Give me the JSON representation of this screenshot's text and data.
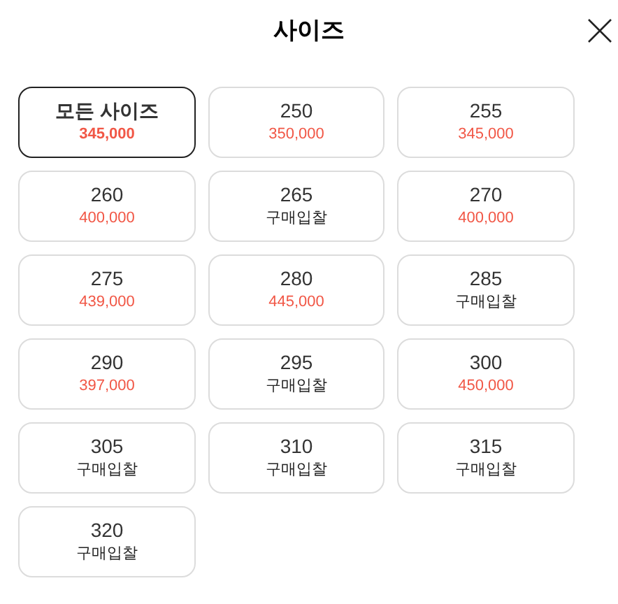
{
  "title": "사이즈",
  "sizes": [
    {
      "label": "모든 사이즈",
      "sub": "345,000",
      "kind": "price",
      "selected": true
    },
    {
      "label": "250",
      "sub": "350,000",
      "kind": "price",
      "selected": false
    },
    {
      "label": "255",
      "sub": "345,000",
      "kind": "price",
      "selected": false
    },
    {
      "label": "260",
      "sub": "400,000",
      "kind": "price",
      "selected": false
    },
    {
      "label": "265",
      "sub": "구매입찰",
      "kind": "bid",
      "selected": false
    },
    {
      "label": "270",
      "sub": "400,000",
      "kind": "price",
      "selected": false
    },
    {
      "label": "275",
      "sub": "439,000",
      "kind": "price",
      "selected": false
    },
    {
      "label": "280",
      "sub": "445,000",
      "kind": "price",
      "selected": false
    },
    {
      "label": "285",
      "sub": "구매입찰",
      "kind": "bid",
      "selected": false
    },
    {
      "label": "290",
      "sub": "397,000",
      "kind": "price",
      "selected": false
    },
    {
      "label": "295",
      "sub": "구매입찰",
      "kind": "bid",
      "selected": false
    },
    {
      "label": "300",
      "sub": "450,000",
      "kind": "price",
      "selected": false
    },
    {
      "label": "305",
      "sub": "구매입찰",
      "kind": "bid",
      "selected": false
    },
    {
      "label": "310",
      "sub": "구매입찰",
      "kind": "bid",
      "selected": false
    },
    {
      "label": "315",
      "sub": "구매입찰",
      "kind": "bid",
      "selected": false
    },
    {
      "label": "320",
      "sub": "구매입찰",
      "kind": "bid",
      "selected": false
    }
  ]
}
